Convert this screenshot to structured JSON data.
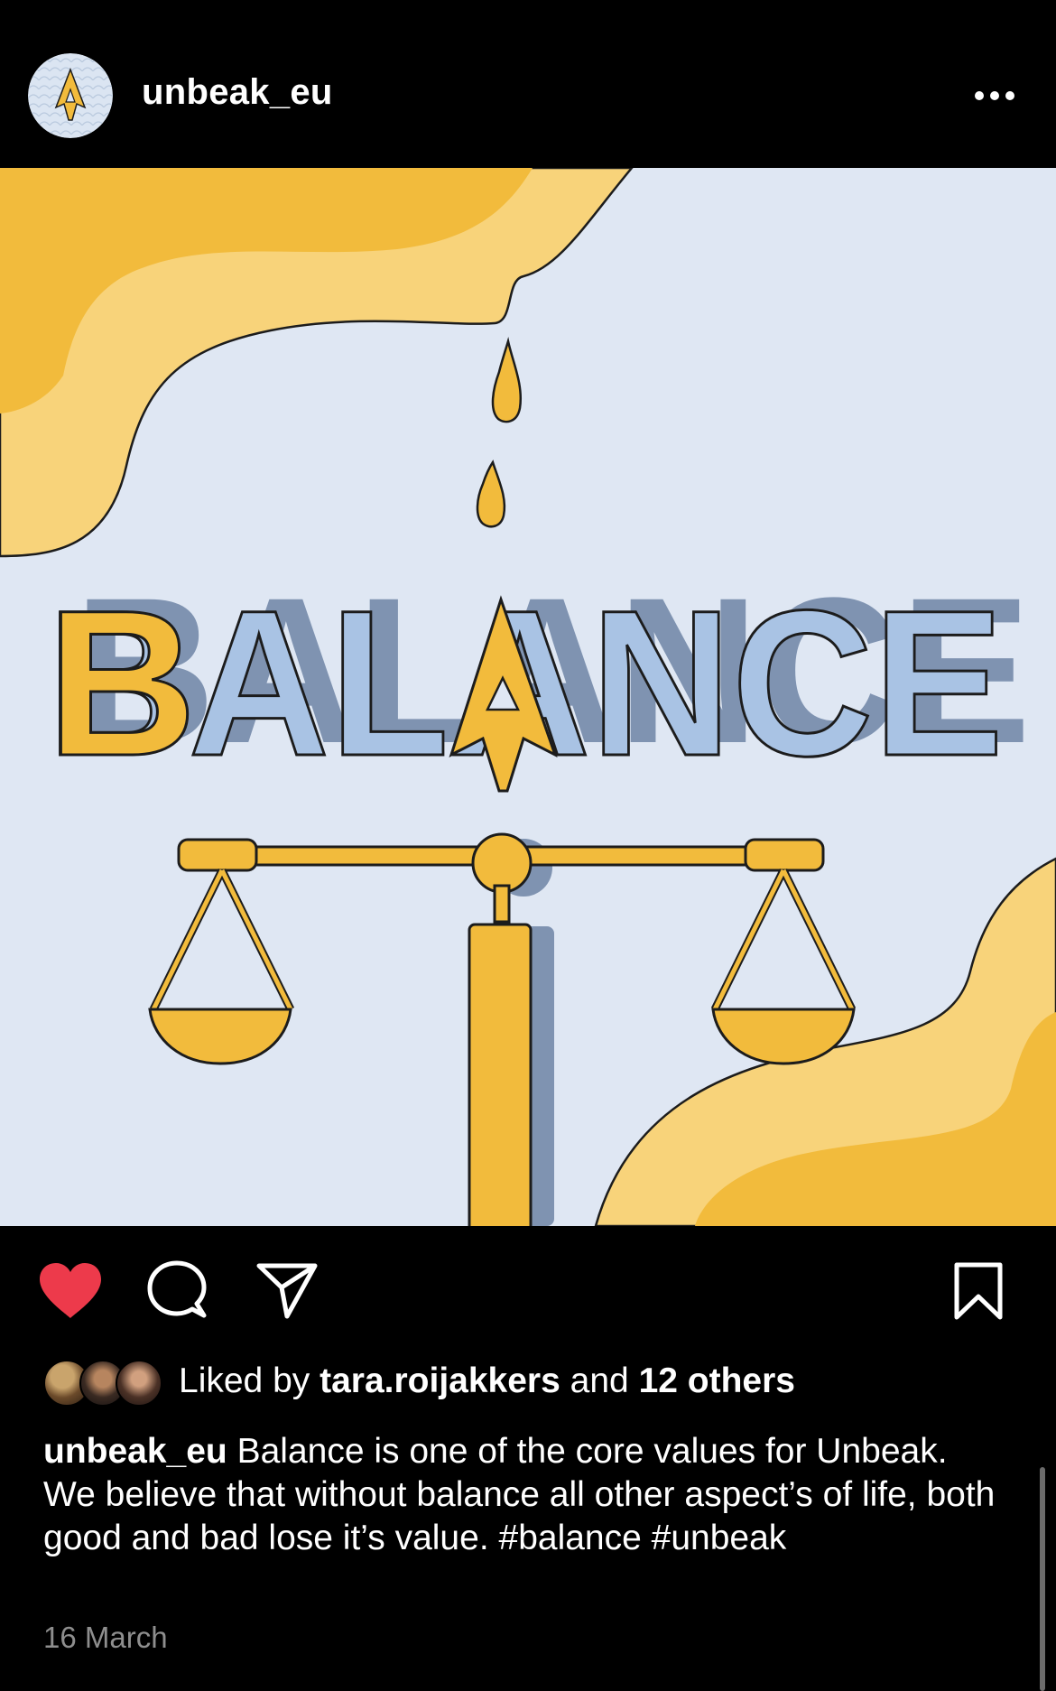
{
  "header": {
    "username": "unbeak_eu",
    "more_icon": "ellipsis-horizontal-icon"
  },
  "post": {
    "image_text": "BALANCE",
    "colors": {
      "background": "#dfe7f3",
      "yellow": "#f2bb3c",
      "light_yellow": "#f8d37a",
      "blue": "#a9c3e4",
      "shadow": "#7f93b1",
      "outline": "#1c1c1c"
    }
  },
  "actions": {
    "like_icon": "heart-filled-icon",
    "comment_icon": "comment-bubble-icon",
    "share_icon": "paper-plane-icon",
    "save_icon": "bookmark-icon",
    "like_color": "#ed3a4b"
  },
  "likes": {
    "prefix": "Liked by",
    "user": "tara.roijakkers",
    "connector": "and",
    "others": "12 others"
  },
  "caption": {
    "username": "unbeak_eu",
    "text": "Balance is one of the core values for Unbeak. We believe that without balance all other aspect’s of life, both good and bad lose it’s value.",
    "hashtags": "#balance #unbeak"
  },
  "date": "16 March"
}
